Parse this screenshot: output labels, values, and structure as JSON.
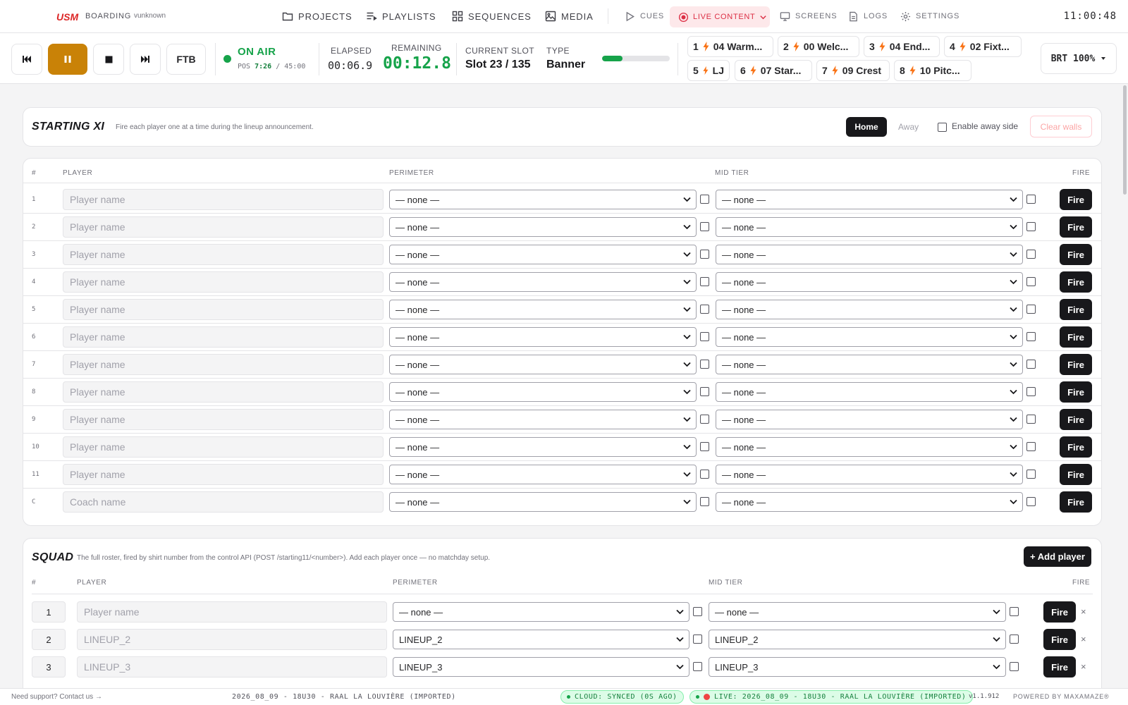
{
  "app": {
    "logo": "USM",
    "project": "BOARDING",
    "user": "vunknown",
    "clock": "11:00:48"
  },
  "nav": {
    "projects": "PROJECTS",
    "playlists": "PLAYLISTS",
    "sequences": "SEQUENCES",
    "media": "MEDIA",
    "cues": "CUES",
    "live_content": "LIVE CONTENT",
    "screens": "SCREENS",
    "logs": "LOGS",
    "settings": "SETTINGS"
  },
  "transport": {
    "ftb": "FTB",
    "status": "ON AIR",
    "pos_label": "POS",
    "pos_current": "7:26",
    "pos_total": "/ 45:00",
    "elapsed_label": "ELAPSED",
    "elapsed": "00:06.9",
    "remaining_label": "REMAINING",
    "remaining": "00:12.8",
    "slot_label": "CURRENT SLOT",
    "slot": "Slot 23 / 135",
    "type_label": "TYPE",
    "type": "Banner",
    "progress_fraction": 0.3,
    "brt": "BRT 100%"
  },
  "quick": [
    {
      "num": "1",
      "label": "04 Warm..."
    },
    {
      "num": "2",
      "label": "00 Welc..."
    },
    {
      "num": "3",
      "label": "04 End..."
    },
    {
      "num": "4",
      "label": "02 Fixt..."
    },
    {
      "num": "5",
      "label": "LJ"
    },
    {
      "num": "6",
      "label": "07 Star..."
    },
    {
      "num": "7",
      "label": "09 Crest"
    },
    {
      "num": "8",
      "label": "10 Pitc..."
    }
  ],
  "starting": {
    "title": "STARTING XI",
    "subtitle": "Fire each player one at a time during the lineup announcement.",
    "home": "Home",
    "away": "Away",
    "enable_away": "Enable away side",
    "clear": "Clear walls",
    "headers": {
      "num": "#",
      "player": "PLAYER",
      "perimeter": "PERIMETER",
      "mid": "MID TIER",
      "fire": "FIRE"
    },
    "rows": [
      {
        "num": "1",
        "placeholder": "Player name",
        "perimeter": "— none —",
        "mid": "— none —"
      },
      {
        "num": "2",
        "placeholder": "Player name",
        "perimeter": "— none —",
        "mid": "— none —"
      },
      {
        "num": "3",
        "placeholder": "Player name",
        "perimeter": "— none —",
        "mid": "— none —"
      },
      {
        "num": "4",
        "placeholder": "Player name",
        "perimeter": "— none —",
        "mid": "— none —"
      },
      {
        "num": "5",
        "placeholder": "Player name",
        "perimeter": "— none —",
        "mid": "— none —"
      },
      {
        "num": "6",
        "placeholder": "Player name",
        "perimeter": "— none —",
        "mid": "— none —"
      },
      {
        "num": "7",
        "placeholder": "Player name",
        "perimeter": "— none —",
        "mid": "— none —"
      },
      {
        "num": "8",
        "placeholder": "Player name",
        "perimeter": "— none —",
        "mid": "— none —"
      },
      {
        "num": "9",
        "placeholder": "Player name",
        "perimeter": "— none —",
        "mid": "— none —"
      },
      {
        "num": "10",
        "placeholder": "Player name",
        "perimeter": "— none —",
        "mid": "— none —"
      },
      {
        "num": "11",
        "placeholder": "Player name",
        "perimeter": "— none —",
        "mid": "— none —"
      },
      {
        "num": "C",
        "placeholder": "Coach name",
        "perimeter": "— none —",
        "mid": "— none —"
      }
    ],
    "fire_label": "Fire"
  },
  "squad": {
    "title": "SQUAD",
    "subtitle": "The full roster, fired by shirt number from the control API (POST /starting11/<number>). Add each player once — no matchday setup.",
    "add": "+ Add player",
    "headers": {
      "num": "#",
      "player": "PLAYER",
      "perimeter": "PERIMETER",
      "mid": "MID TIER",
      "fire": "FIRE"
    },
    "rows": [
      {
        "num": "1",
        "placeholder": "Player name",
        "perimeter": "— none —",
        "mid": "— none —"
      },
      {
        "num": "2",
        "placeholder": "LINEUP_2",
        "perimeter": "LINEUP_2",
        "mid": "LINEUP_2"
      },
      {
        "num": "3",
        "placeholder": "LINEUP_3",
        "perimeter": "LINEUP_3",
        "mid": "LINEUP_3"
      }
    ],
    "fire_label": "Fire",
    "remove": "×"
  },
  "footer": {
    "support": "Need support? Contact us →",
    "session": "2026_08_09 - 18U30 - RAAL LA LOUVIÈRE (IMPORTED)",
    "cloud": "CLOUD: SYNCED (0S AGO)",
    "live": "LIVE: 2026_08_09 - 18U30 - RAAL LA LOUVIÈRE (IMPORTED)",
    "version": "v1.1.912",
    "powered": "POWERED BY MAXAMAZE®"
  },
  "colors": {
    "accent_pause": "#c98207",
    "onair": "#16a34a",
    "live": "#dc2f45",
    "fire": "#18181b"
  },
  "icons": {
    "projects": "folder-icon",
    "playlists": "playlist-icon",
    "sequences": "grid-icon",
    "media": "image-icon",
    "cues": "play-outline-icon",
    "live": "broadcast-icon",
    "screens": "monitor-icon",
    "logs": "document-icon",
    "settings": "gear-icon",
    "quick": "bolt-icon"
  }
}
